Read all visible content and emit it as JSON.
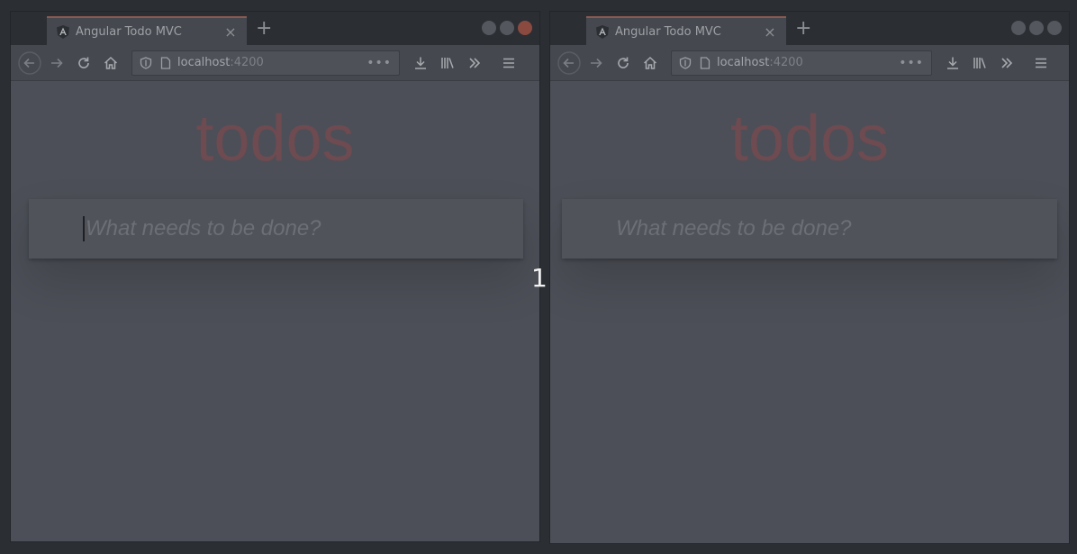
{
  "step_label": "1",
  "windows": [
    {
      "tab_title": "Angular Todo MVC",
      "new_tab": "+",
      "url_host": "localhost",
      "url_port": ":4200",
      "url_more": "•••",
      "page_title": "todos",
      "input_placeholder": "What needs to be done?",
      "input_focused": true
    },
    {
      "tab_title": "Angular Todo MVC",
      "new_tab": "+",
      "url_host": "localhost",
      "url_port": ":4200",
      "url_more": "•••",
      "page_title": "todos",
      "input_placeholder": "What needs to be done?",
      "input_focused": false
    }
  ],
  "icons": {
    "favicon": "angular-icon",
    "back": "back-arrow-icon",
    "forward": "forward-arrow-icon",
    "reload": "reload-icon",
    "home": "home-icon",
    "shield": "tracking-shield-icon",
    "page": "page-icon",
    "download": "download-icon",
    "library": "library-icon",
    "overflow": "chevron-double-right-icon",
    "menu": "hamburger-menu-icon"
  },
  "colors": {
    "title": "#6e4a51",
    "overlay": "#4c4f57",
    "tab_accent": "#8a5a52"
  }
}
